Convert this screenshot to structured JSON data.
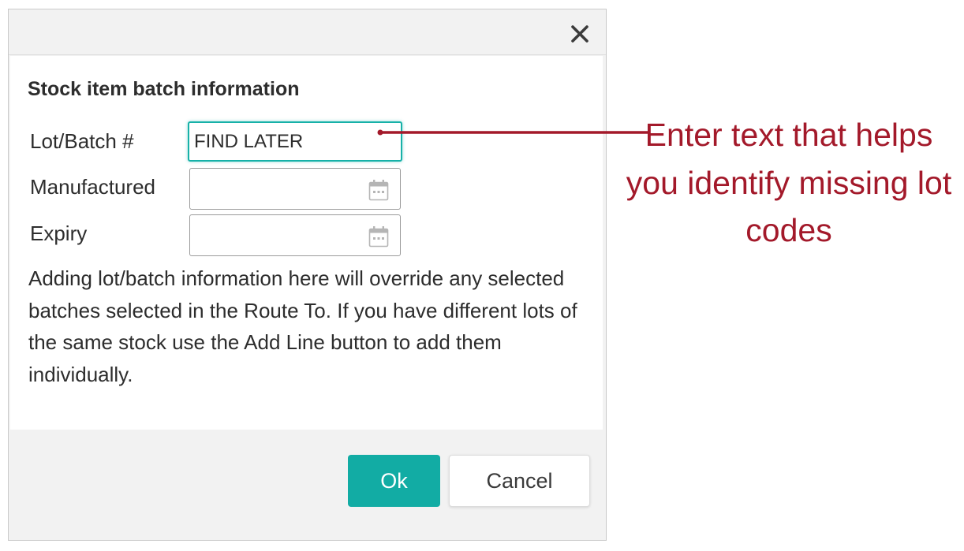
{
  "dialog": {
    "title": "Stock item batch information",
    "close_icon": "close-icon",
    "fields": {
      "lot_batch": {
        "label": "Lot/Batch #",
        "value": "FIND LATER"
      },
      "manufactured": {
        "label": "Manufactured",
        "value": "",
        "icon": "calendar-icon"
      },
      "expiry": {
        "label": "Expiry",
        "value": "",
        "icon": "calendar-icon"
      }
    },
    "help_text": "Adding lot/batch information here will override any selected batches selected in the Route To. If you have different lots of the same stock use the Add Line button to add them individually.",
    "buttons": {
      "ok": "Ok",
      "cancel": "Cancel"
    }
  },
  "annotation": {
    "text": "Enter text that helps you identify missing lot codes",
    "color": "#a3192a"
  },
  "colors": {
    "accent": "#12aca4",
    "focus_border": "#17b1a8"
  }
}
